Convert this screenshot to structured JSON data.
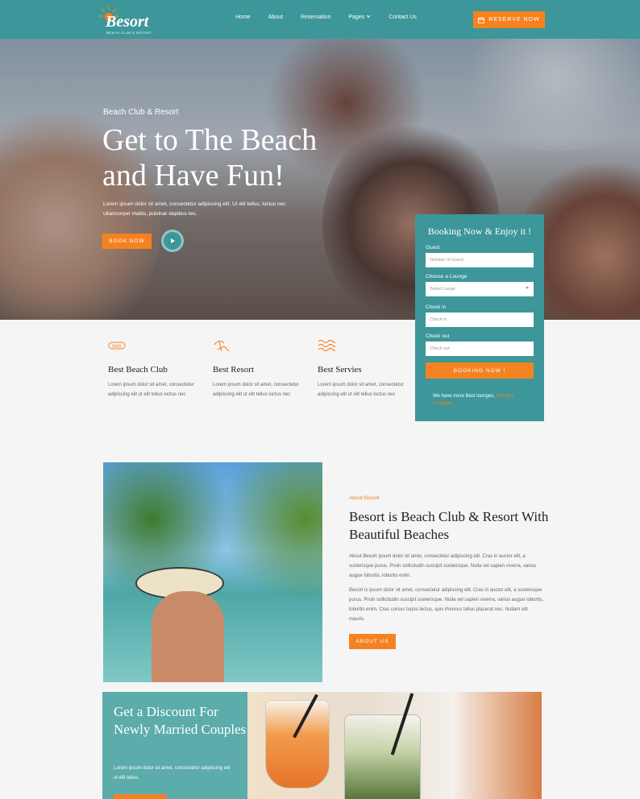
{
  "colors": {
    "teal": "#3d9699",
    "orange": "#f58220"
  },
  "header": {
    "brand": "Besort",
    "tagline": "BEACH CLUB & RESORT",
    "nav": [
      "Home",
      "About",
      "Reservation",
      "Pages",
      "Contact Us"
    ],
    "reserve_label": "RESERVE NOW",
    "reserve_icon": "calendar-icon"
  },
  "hero": {
    "subtitle": "Beach Club & Resort",
    "title_line1": "Get to The Beach",
    "title_line2": "and Have Fun!",
    "description": "Lorem ipsum dolor sit amet, consectetur adipiscing elit. Ut elit tellus, luctus nec ullamcorper mattis, pulvinar dapibus leo.",
    "book_label": "BOOK NOW"
  },
  "booking": {
    "title": "Booking Now & Enjoy it !",
    "guest_label": "Guest",
    "guest_placeholder": "Number of Guest",
    "lounge_label": "Choose a Lounge",
    "lounge_placeholder": "Select Lauge",
    "checkin_label": "Check in",
    "checkin_placeholder": "Check in",
    "checkout_label": "Check out",
    "checkout_placeholder": "Check out",
    "submit_label": "BOOKING NOW !",
    "note": "We have more Best lounges,",
    "note_link": "Check it Lounges"
  },
  "features": [
    {
      "icon": "bar-icon",
      "title": "Best Beach Club",
      "text": "Lorem ipsum dolor sit amet, consectetur adipiscing elit ut elit tellus luctus nec"
    },
    {
      "icon": "beach-chair-icon",
      "title": "Best Resort",
      "text": "Lorem ipsum dolor sit amet, consectetur adipiscing elit ut elit tellus luctus nec"
    },
    {
      "icon": "waves-icon",
      "title": "Best Servies",
      "text": "Lorem ipsum dolor sit amet, consectetur adipiscing elit ut elit tellus luctus nec"
    }
  ],
  "about": {
    "kicker": "About Besort",
    "title": "Besort is Beach Club & Resort With Beautiful Beaches",
    "p1": "About Besort ipsum dolor sit amet, consectetur adipiscing elit. Cras in auctor elit, a scelerisque purus. Proin sollicitudin suscipit scelerisque. Nulla vel sapien viverra, varius augue lobortis, lobortis enim.",
    "p2": "Besort is ipsum dolor sit amet, consectetur adipiscing elit. Cras in auctor elit, a scelerisque purus. Proin sollicitudin suscipit scelerisque. Nulla vel sapien viverra, varius augue lobortis, lobortis enim. Cras cursus turpis lectus, quis rhoncus tellus placerat nec. Nullam elit mauris.",
    "button_label": "ABOUT US"
  },
  "discount": {
    "title": "Get a Discount For Newly Married Couples",
    "description": "Lorem ipsum dolor sit amet, consectetur adipiscing elit ut elit tellus."
  }
}
